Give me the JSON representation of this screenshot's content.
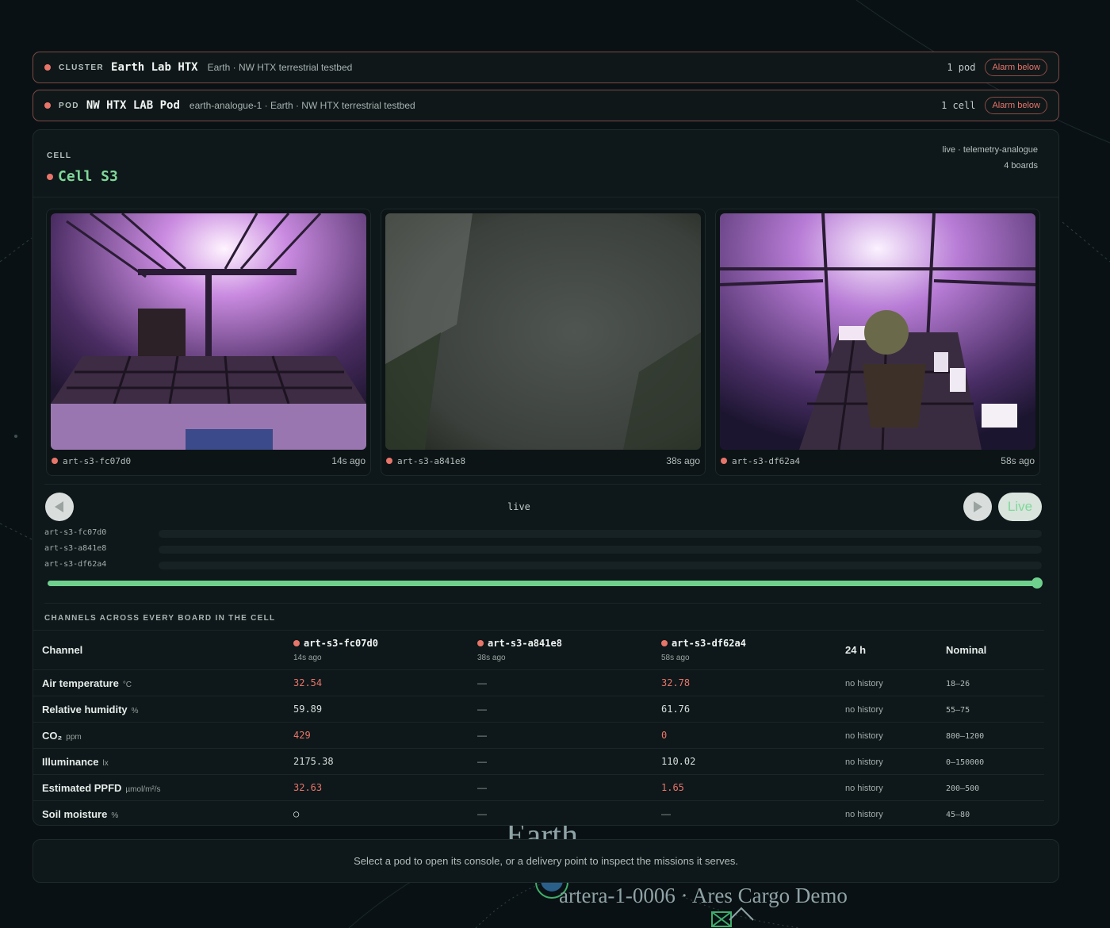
{
  "cluster": {
    "kind": "CLUSTER",
    "name": "Earth Lab HTX",
    "meta": "Earth · NW HTX terrestrial testbed",
    "count": "1 pod",
    "alarm": "Alarm below"
  },
  "pod": {
    "kind": "POD",
    "name": "NW HTX LAB Pod",
    "meta": "earth-analogue-1 · Earth · NW HTX terrestrial testbed",
    "count": "1 cell",
    "alarm": "Alarm below"
  },
  "cell": {
    "kind": "CELL",
    "name": "Cell S3",
    "status_line1": "live · telemetry-analogue",
    "status_line2": "4 boards"
  },
  "cameras": [
    {
      "id": "art-s3-fc07d0",
      "age": "14s ago"
    },
    {
      "id": "art-s3-a841e8",
      "age": "38s ago"
    },
    {
      "id": "art-s3-df62a4",
      "age": "58s ago"
    }
  ],
  "playback": {
    "state": "live",
    "live_label": "Live",
    "prev_icon": "play-back-icon",
    "next_icon": "play-forward-icon",
    "tracks": [
      "art-s3-fc07d0",
      "art-s3-a841e8",
      "art-s3-df62a4"
    ],
    "position": 1.0
  },
  "channels": {
    "title": "CHANNELS ACROSS EVERY BOARD IN THE CELL",
    "headers": {
      "channel": "Channel",
      "boards": [
        {
          "id": "art-s3-fc07d0",
          "age": "14s ago"
        },
        {
          "id": "art-s3-a841e8",
          "age": "38s ago"
        },
        {
          "id": "art-s3-df62a4",
          "age": "58s ago"
        }
      ],
      "history": "24 h",
      "nominal": "Nominal"
    },
    "rows": [
      {
        "name": "Air temperature",
        "unit": "°C",
        "v1": "32.54",
        "v2": "—",
        "v3": "32.78",
        "history": "no history",
        "nominal": "18–26"
      },
      {
        "name": "Relative humidity",
        "unit": "%",
        "v1": "59.89",
        "v2": "—",
        "v3": "61.76",
        "history": "no history",
        "nominal": "55–75"
      },
      {
        "name": "CO₂",
        "unit": "ppm",
        "v1": "429",
        "v2": "—",
        "v3": "0",
        "history": "no history",
        "nominal": "800–1200"
      },
      {
        "name": "Illuminance",
        "unit": "lx",
        "v1": "2175.38",
        "v2": "—",
        "v3": "110.02",
        "history": "no history",
        "nominal": "0–150000"
      },
      {
        "name": "Estimated PPFD",
        "unit": "µmol/m²/s",
        "v1": "32.63",
        "v2": "—",
        "v3": "1.65",
        "history": "no history",
        "nominal": "200–500"
      },
      {
        "name": "Soil moisture",
        "unit": "%",
        "v1": "○",
        "v2": "—",
        "v3": "—",
        "history": "no history",
        "nominal": "45–80"
      }
    ]
  },
  "hint": "Select a pod to open its console, or a delivery point to inspect the missions it serves.",
  "map": {
    "planet_label": "Earth",
    "route_label": "artera-1-0006 · Ares Cargo Demo"
  },
  "colors": {
    "accent": "#7fd89a",
    "alarm": "#e8756a",
    "background": "#0a1114"
  }
}
